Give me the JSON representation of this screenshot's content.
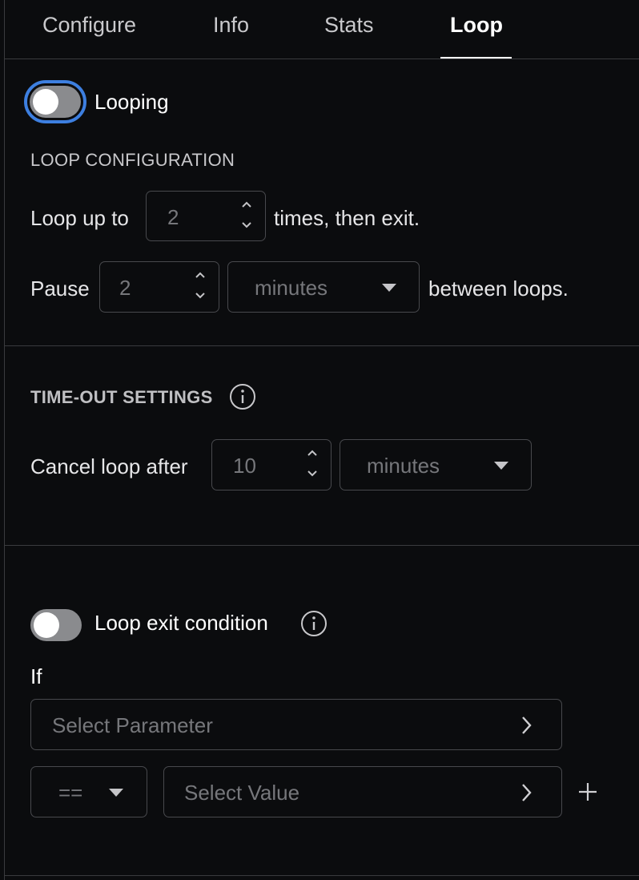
{
  "tabs": [
    {
      "label": "Configure"
    },
    {
      "label": "Info"
    },
    {
      "label": "Stats"
    },
    {
      "label": "Loop"
    }
  ],
  "active_tab": "Loop",
  "looping": {
    "label": "Looping",
    "enabled": false
  },
  "loop_config": {
    "heading": "LOOP CONFIGURATION",
    "loop_prefix": "Loop up to",
    "loop_count": "2",
    "loop_suffix": "times, then exit.",
    "pause_prefix": "Pause",
    "pause_value": "2",
    "pause_unit": "minutes",
    "pause_suffix": "between loops."
  },
  "timeout": {
    "heading": "TIME-OUT SETTINGS",
    "cancel_prefix": "Cancel loop after",
    "cancel_value": "10",
    "cancel_unit": "minutes"
  },
  "exit_condition": {
    "label": "Loop exit condition",
    "enabled": false,
    "if_label": "If",
    "parameter_placeholder": "Select Parameter",
    "operator": "==",
    "value_placeholder": "Select Value"
  },
  "colors": {
    "background": "#0b0c0e",
    "focus_ring": "#3d7fe0",
    "toggle_off": "#8a8b8e"
  }
}
